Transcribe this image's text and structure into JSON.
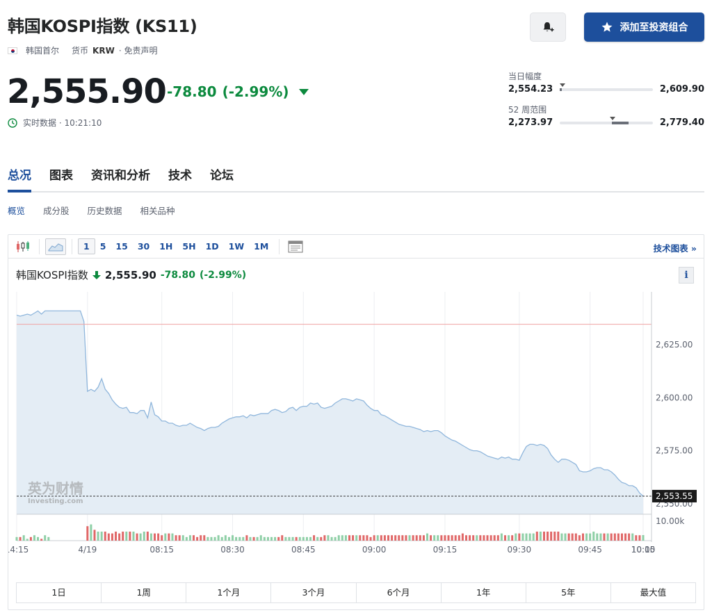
{
  "header": {
    "title": "韩国KOSPI指数 (KS11)",
    "location": "韩国首尔",
    "currency_label": "货币",
    "currency": "KRW",
    "disclaimer": "· 免责声明",
    "add_button": "添加至投资组合"
  },
  "quote": {
    "price": "2,555.90",
    "change": "-78.80",
    "change_pct": "(-2.99%)",
    "status": "实时数据 · 10:21:10",
    "day_range": {
      "label": "当日幅度",
      "low": "2,554.23",
      "high": "2,609.90"
    },
    "week52_range": {
      "label": "52 周范围",
      "low": "2,273.97",
      "high": "2,779.40"
    }
  },
  "tabs": [
    "总况",
    "图表",
    "资讯和分析",
    "技术",
    "论坛"
  ],
  "subtabs": [
    "概览",
    "成分股",
    "历史数据",
    "相关品种"
  ],
  "chart_toolbar": {
    "intervals": [
      "1",
      "5",
      "15",
      "30",
      "1H",
      "5H",
      "1D",
      "1W",
      "1M"
    ],
    "active_interval": "1",
    "tech_chart_link": "技术图表 »"
  },
  "chart_header": {
    "name": "韩国KOSPI指数",
    "price": "2,555.90",
    "change": "-78.80",
    "change_pct": "(-2.99%)"
  },
  "watermark": {
    "cn": "英为财情",
    "en": "Investing.com"
  },
  "range_buttons": [
    "1日",
    "1周",
    "1个月",
    "3个月",
    "6个月",
    "1年",
    "5年",
    "最大值"
  ],
  "colors": {
    "accent": "#1d4f9c",
    "up": "#0c8a3e",
    "area_line": "#8fb6dc",
    "area_fill": "#e4edf5",
    "prev_close": "#f0a3a3",
    "vol_up": "#8ecfa6",
    "vol_down": "#e06767"
  },
  "chart_data": {
    "type": "area",
    "x_ticks": [
      "14:15",
      "4/19",
      "08:15",
      "08:30",
      "08:45",
      "09:00",
      "09:15",
      "09:30",
      "09:45",
      "10:00",
      "10:15"
    ],
    "y_ticks": [
      "2,625.00",
      "2,600.00",
      "2,575.00",
      "2,550.00"
    ],
    "ylim": [
      2545,
      2650
    ],
    "prev_close": 2634.7,
    "last_label": "2,553.55",
    "volume_tick": "10.00k",
    "series": [
      {
        "values": [
          2639,
          2638.5,
          2639,
          2639.5,
          2639,
          2640,
          2641,
          2639.5,
          2641,
          2641,
          2641,
          2641,
          2641,
          2641,
          2641,
          2641,
          2641,
          2641,
          2641,
          2636,
          2603,
          2604,
          2603,
          2605,
          2609,
          2604,
          2602,
          2599,
          2597,
          2595.5,
          2595,
          2595.5,
          2593,
          2593,
          2592.5,
          2594,
          2594,
          2590.5,
          2598,
          2592,
          2591,
          2589,
          2589,
          2588,
          2588,
          2587,
          2586.5,
          2587,
          2587,
          2588,
          2587,
          2586,
          2585.5,
          2584.5,
          2585.5,
          2586,
          2586,
          2586.5,
          2588,
          2589,
          2590,
          2590.5,
          2591,
          2591,
          2591.5,
          2590.5,
          2592,
          2591.5,
          2592,
          2592.5,
          2592.5,
          2592.5,
          2594,
          2594.5,
          2594,
          2593,
          2593.5,
          2595,
          2595.5,
          2594,
          2595.5,
          2596,
          2596,
          2597.5,
          2597,
          2597.5,
          2595.5,
          2595,
          2595.5,
          2596,
          2597.5,
          2598.5,
          2599.5,
          2599.5,
          2599,
          2598.5,
          2599.5,
          2599,
          2598.5,
          2596.5,
          2595,
          2594,
          2594,
          2592,
          2591.5,
          2590.5,
          2589.5,
          2588.5,
          2587.5,
          2587,
          2586.5,
          2586.5,
          2586,
          2585.5,
          2585,
          2584,
          2584.5,
          2584,
          2584.5,
          2584.5,
          2583.5,
          2582,
          2581,
          2580,
          2579.5,
          2578.5,
          2577.5,
          2576.5,
          2575.5,
          2575,
          2575,
          2574.5,
          2573.5,
          2572.5,
          2572,
          2571.5,
          2571,
          2572,
          2571.5,
          2572,
          2571,
          2571,
          2570.5,
          2574,
          2577,
          2578,
          2578,
          2577.5,
          2578,
          2577.5,
          2576,
          2573,
          2571,
          2569.5,
          2571,
          2571,
          2570.5,
          2569.5,
          2568.5,
          2565.5,
          2565,
          2565,
          2565.5,
          2566.5,
          2567,
          2567,
          2566,
          2566,
          2565,
          2563.5,
          2561.5,
          2560,
          2559.5,
          2558.5,
          2558.5,
          2557.5,
          2555,
          2553.55
        ]
      }
    ],
    "volume_values": [
      2,
      2,
      3,
      1,
      2,
      3,
      2,
      1,
      3,
      2,
      0,
      0,
      0,
      0,
      0,
      0,
      0,
      0,
      0,
      0,
      8,
      9,
      6,
      5,
      5,
      5,
      4,
      4,
      5,
      4,
      5,
      5,
      5,
      5,
      4,
      4,
      5,
      5,
      4,
      4,
      4,
      3,
      4,
      4,
      4,
      3,
      3,
      3,
      2,
      3,
      3,
      2,
      3,
      3,
      2,
      2,
      2,
      3,
      2,
      3,
      2,
      3,
      2,
      2,
      2,
      3,
      2,
      2,
      2,
      3,
      2,
      2,
      2,
      2,
      2,
      3,
      2,
      2,
      2,
      2,
      2,
      2,
      2,
      2,
      3,
      2,
      2,
      3,
      3,
      2,
      2,
      3,
      3,
      3,
      3,
      3,
      3,
      3,
      3,
      3,
      2,
      3,
      3,
      3,
      3,
      3,
      3,
      3,
      3,
      3,
      3,
      3,
      3,
      3,
      3,
      3,
      4,
      3,
      3,
      3,
      3,
      3,
      3,
      3,
      3,
      3,
      4,
      3,
      3,
      3,
      3,
      3,
      3,
      3,
      3,
      3,
      3,
      4,
      3,
      3,
      3,
      4,
      4,
      4,
      4,
      4,
      4,
      5,
      5,
      5,
      5,
      5,
      5,
      5,
      4,
      4,
      4,
      4,
      4,
      3,
      4,
      4,
      4,
      5,
      4,
      4,
      4,
      4,
      4,
      4,
      4,
      4,
      4,
      4,
      4,
      3,
      3,
      3,
      3,
      3,
      3
    ]
  }
}
